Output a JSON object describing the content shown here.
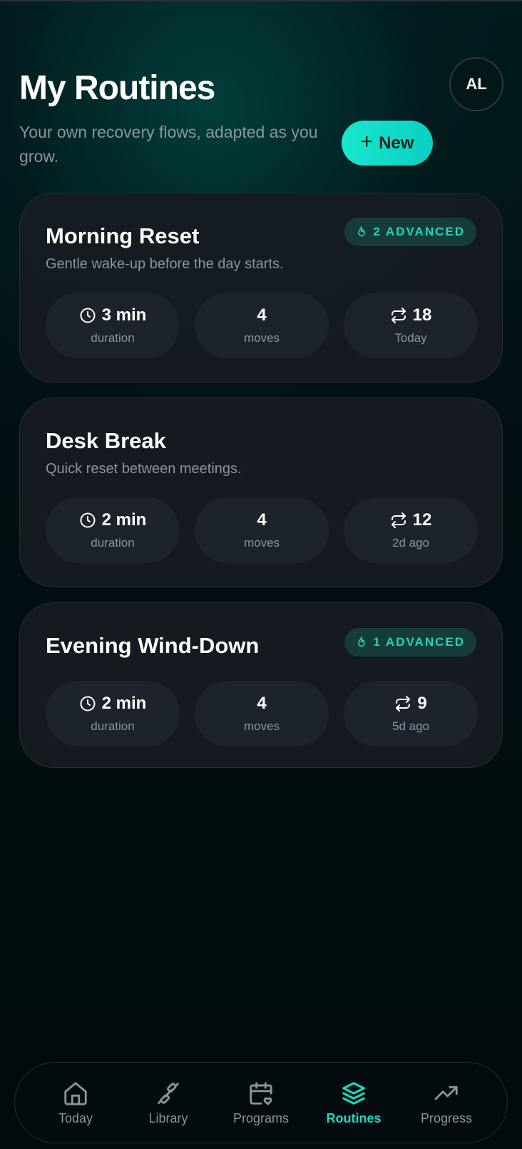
{
  "header": {
    "title": "My Routines",
    "subtitle": "Your own recovery flows, adapted as you grow.",
    "avatar_initials": "AL",
    "new_button_label": "New"
  },
  "routines": [
    {
      "title": "Morning Reset",
      "description": "Gentle wake-up before the day starts.",
      "badge": "2 ADVANCED",
      "duration_value": "3 min",
      "duration_label": "duration",
      "moves_value": "4",
      "moves_label": "moves",
      "count_value": "18",
      "last_done": "Today"
    },
    {
      "title": "Desk Break",
      "description": "Quick reset between meetings.",
      "badge": "",
      "duration_value": "2 min",
      "duration_label": "duration",
      "moves_value": "4",
      "moves_label": "moves",
      "count_value": "12",
      "last_done": "2d ago"
    },
    {
      "title": "Evening Wind-Down",
      "description": "",
      "badge": "1 ADVANCED",
      "duration_value": "2 min",
      "duration_label": "duration",
      "moves_value": "4",
      "moves_label": "moves",
      "count_value": "9",
      "last_done": "5d ago"
    }
  ],
  "nav": {
    "items": [
      {
        "label": "Today",
        "icon": "home-icon"
      },
      {
        "label": "Library",
        "icon": "dumbbell-icon"
      },
      {
        "label": "Programs",
        "icon": "calendar-heart-icon"
      },
      {
        "label": "Routines",
        "icon": "layers-icon",
        "active": true
      },
      {
        "label": "Progress",
        "icon": "trending-up-icon"
      }
    ]
  },
  "colors": {
    "accent": "#1ed8c0",
    "badge_bg": "#163c39",
    "card_bg": "#161b22",
    "stat_bg": "#1c232a"
  }
}
